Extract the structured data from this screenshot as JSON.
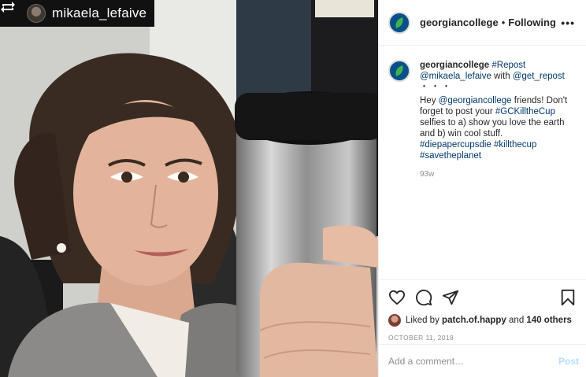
{
  "photo": {
    "repost_username": "mikaela_lefaive",
    "repost_icon": "repost-icon",
    "alt": "photo"
  },
  "header": {
    "username": "georgiancollege",
    "separator": "•",
    "follow_state": "Following",
    "more_icon": "more-options-icon",
    "more_label": "•••"
  },
  "caption": {
    "username": "georgiancollege",
    "repost_tag": "#Repost",
    "via_user": "@mikaela_lefaive",
    "with_word": "with",
    "app_user": "@get_repost",
    "dots": "・・・",
    "greeting": "Hey",
    "mention": "@georgiancollege",
    "text_1": "friends! Don't forget to post your",
    "hashtag_1": "#GCKilltheCup",
    "text_2": "selfies to a) show you love the earth and b) win cool stuff.",
    "hashtag_2": "#diepapercupsdie",
    "hashtag_3": "#killthecup",
    "hashtag_4": "#savetheplanet",
    "age": "93w"
  },
  "actions": {
    "like_icon": "heart-icon",
    "comment_icon": "comment-icon",
    "share_icon": "share-icon",
    "save_icon": "bookmark-icon",
    "liked_by_prefix": "Liked by",
    "liked_by_user": "patch.of.happy",
    "and_word": "and",
    "others": "140 others",
    "date": "OCTOBER 11, 2018"
  },
  "comment": {
    "placeholder": "Add a comment…",
    "post_label": "Post"
  },
  "colors": {
    "link": "#00376b",
    "muted": "#8e8e8e",
    "post_disabled": "#b2dffc",
    "brand_logo": "#0b4f8a",
    "brand_leaf": "#3cb54a"
  }
}
